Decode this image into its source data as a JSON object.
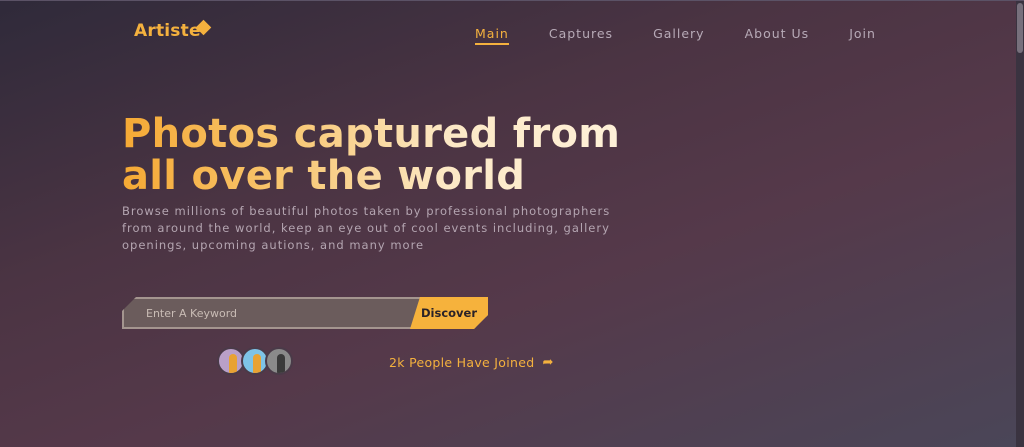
{
  "brand": {
    "name": "Artiste"
  },
  "nav": {
    "items": [
      {
        "label": "Main",
        "active": true
      },
      {
        "label": "Captures",
        "active": false
      },
      {
        "label": "Gallery",
        "active": false
      },
      {
        "label": "About Us",
        "active": false
      },
      {
        "label": "Join",
        "active": false
      }
    ]
  },
  "hero": {
    "title": "Photos captured from all over the world",
    "description": "Browse millions of beautiful photos taken by professional photographers from around the world, keep an eye out of cool events including, gallery openings, upcoming autions, and many more"
  },
  "search": {
    "placeholder": "Enter A Keyword",
    "value": "",
    "button_label": "Discover"
  },
  "community": {
    "joined_text": "2k People Have Joined",
    "avatars": [
      "avatar-1",
      "avatar-2",
      "avatar-3"
    ]
  },
  "colors": {
    "accent": "#f4b13e",
    "text_muted": "#b4a5b1"
  },
  "icons": {
    "share": "share-arrow-icon"
  }
}
